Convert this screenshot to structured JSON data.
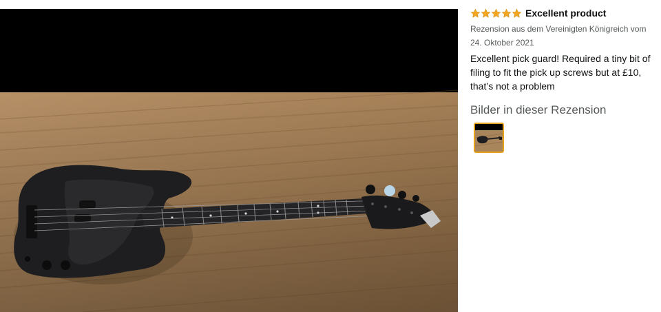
{
  "review": {
    "rating": 5,
    "max_rating": 5,
    "title": "Excellent product",
    "meta": "Rezension aus dem Vereinigten Königreich vom 24. Oktober 2021",
    "body": "Excellent pick guard! Required a tiny bit of filing to fit the pick up screws but at £10, that’s not a problem"
  },
  "images_section": {
    "heading": "Bilder in dieser Rezension"
  },
  "icons": {
    "star": "star-icon"
  },
  "colors": {
    "star": "#f5a623",
    "thumbnail_border": "#e7a21b",
    "title_text": "#111111",
    "meta_text": "#565959"
  }
}
